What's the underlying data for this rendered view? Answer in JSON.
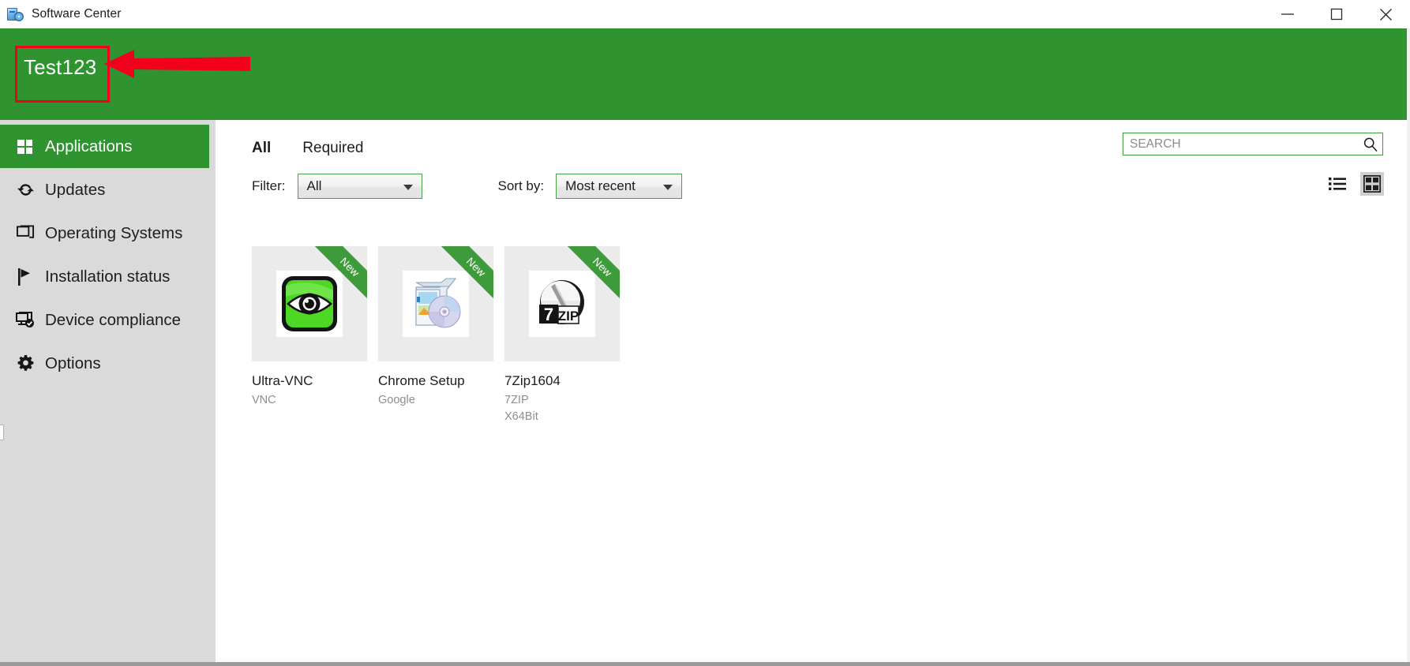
{
  "window": {
    "title": "Software Center",
    "icon": "software-center-icon",
    "controls": {
      "minimize": "Minimize",
      "maximize": "Maximize",
      "close": "Close"
    }
  },
  "brand": {
    "text": "Test123",
    "background_color": "#2f9330"
  },
  "annotation": {
    "highlight_color": "#f3001d",
    "shape": "rectangle-with-arrow",
    "target": "brand-text"
  },
  "sidebar": {
    "items": [
      {
        "label": "Applications",
        "icon": "applications-icon",
        "active": true
      },
      {
        "label": "Updates",
        "icon": "updates-refresh-icon",
        "active": false
      },
      {
        "label": "Operating Systems",
        "icon": "operating-systems-icon",
        "active": false
      },
      {
        "label": "Installation status",
        "icon": "flag-icon",
        "active": false
      },
      {
        "label": "Device compliance",
        "icon": "device-compliance-icon",
        "active": false
      },
      {
        "label": "Options",
        "icon": "gear-icon",
        "active": false
      }
    ]
  },
  "main": {
    "tabs": [
      {
        "label": "All",
        "active": true
      },
      {
        "label": "Required",
        "active": false
      }
    ],
    "filter": {
      "label": "Filter:",
      "value": "All"
    },
    "sort": {
      "label": "Sort by:",
      "value": "Most recent"
    },
    "search": {
      "placeholder": "SEARCH",
      "value": "",
      "icon": "search-icon"
    },
    "view_modes": [
      {
        "name": "list-view",
        "icon": "list-view-icon",
        "active": false
      },
      {
        "name": "grid-view",
        "icon": "grid-view-icon",
        "active": true
      }
    ],
    "apps": [
      {
        "name": "Ultra-VNC",
        "publisher": "VNC",
        "extra": "",
        "badge": "New",
        "icon": "ultravnc-eye-icon"
      },
      {
        "name": "Chrome Setup",
        "publisher": "Google",
        "extra": "",
        "badge": "New",
        "icon": "installer-package-icon"
      },
      {
        "name": "7Zip1604",
        "publisher": "7ZIP",
        "extra": "X64Bit",
        "badge": "New",
        "icon": "sevenzip-icon"
      }
    ]
  },
  "colors": {
    "accent_green": "#2f9330",
    "sidebar_gray": "#dadada",
    "tile_gray": "#ebebeb",
    "annotation_red": "#f3001d"
  }
}
